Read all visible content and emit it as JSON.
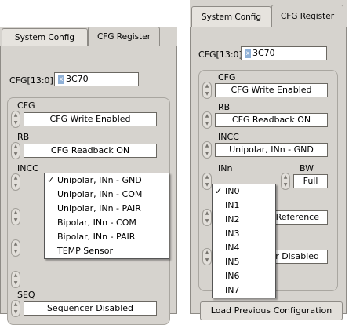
{
  "left": {
    "tabs": [
      "System Config",
      "CFG Register"
    ],
    "cfg_label": "CFG[13:0]",
    "cfg_radix": "x",
    "cfg_value": "3C70",
    "cfg_title": "CFG",
    "cfg_value_ring": "CFG Write Enabled",
    "rb_title": "RB",
    "rb_value": "CFG Readback ON",
    "incc_title": "INCC",
    "seq_title": "SEQ",
    "seq_value": "Sequencer Disabled",
    "incc_menu": {
      "options": [
        "Unipolar, INn - GND",
        "Unipolar, INn - COM",
        "Unipolar, INn - PAIR",
        "Bipolar, INn - COM",
        "Bipolar, INn - PAIR",
        "TEMP Sensor"
      ],
      "checkmark": "✓"
    }
  },
  "right": {
    "tabs": [
      "System Config",
      "CFG Register"
    ],
    "cfg_label": "CFG[13:0]",
    "cfg_radix": "x",
    "cfg_value": "3C70",
    "cfg_title": "CFG",
    "cfg_value_ring": "CFG Write Enabled",
    "rb_title": "RB",
    "rb_value": "CFG Readback ON",
    "incc_title": "INCC",
    "incc_value": "Unipolar, INn - GND",
    "inn_title": "INn",
    "bw_title": "BW",
    "bw_value": "Full",
    "ref_value_partial": "Reference",
    "seq_value_partial": "er Disabled",
    "button_partial": "Load Previous Configuration",
    "inn_menu": {
      "options": [
        "IN0",
        "IN1",
        "IN2",
        "IN3",
        "IN4",
        "IN5",
        "IN6",
        "IN7"
      ],
      "checkmark": "✓"
    }
  }
}
